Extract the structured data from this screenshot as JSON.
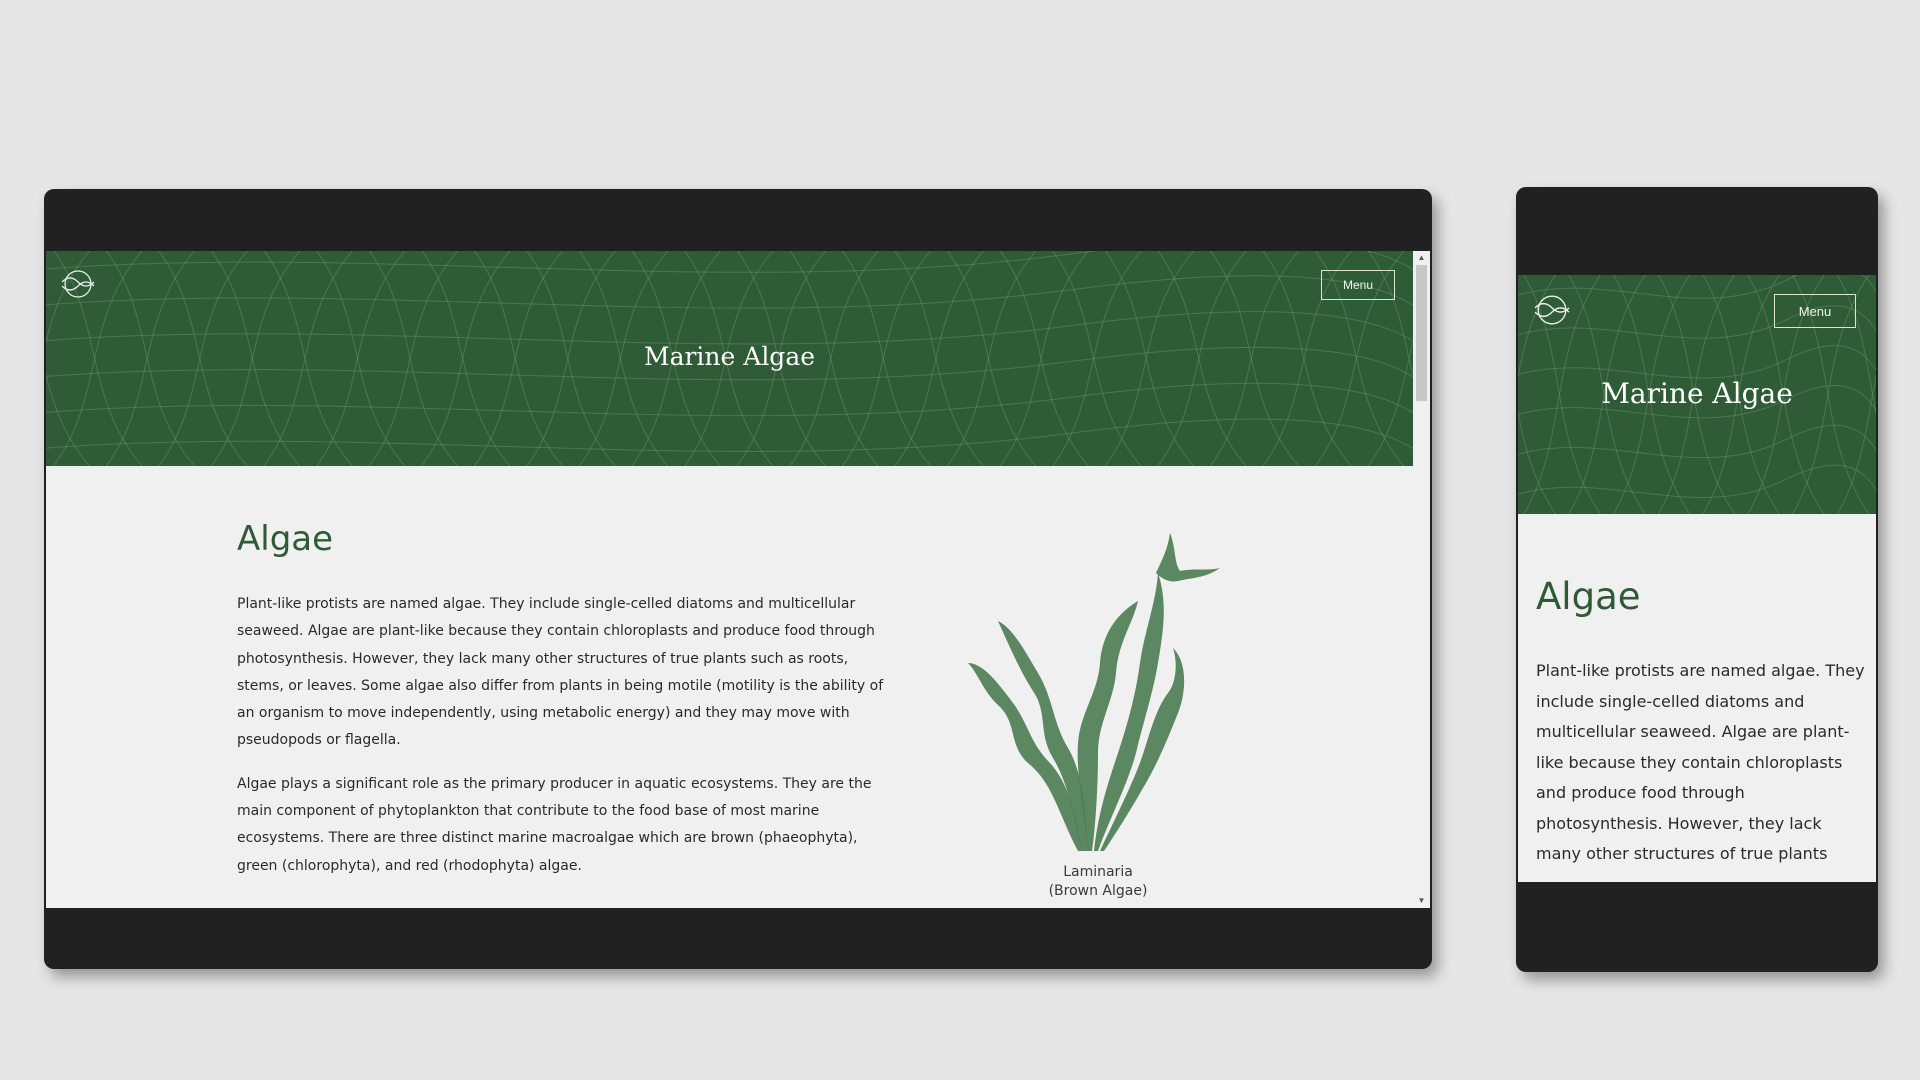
{
  "site": {
    "title": "Marine Algae",
    "menu_label": "Menu"
  },
  "article": {
    "heading": "Algae",
    "paragraph1": "Plant-like protists are named algae. They include single-celled diatoms and multicellular seaweed. Algae are plant-like because they contain chloroplasts and produce food through photosynthesis. However, they lack many other structures of true plants such as roots, stems, or leaves. Some algae also differ from plants in being motile (motility is the ability of an organism to move independently, using metabolic energy) and they may move with pseudopods or flagella.",
    "paragraph2": "Algae plays a significant role as the primary producer in aquatic ecosystems. They are the main component of phytoplankton that contribute to the food base of most marine ecosystems. There are three distinct marine macroalgae which are brown (phaeophyta), green (chlorophyta), and red (rhodophyta) algae.",
    "figure_caption_line1": "Laminaria",
    "figure_caption_line2": "(Brown Algae)"
  },
  "mobile": {
    "paragraph_visible": "Plant-like protists are named algae. They include single-celled diatoms and multicellular seaweed. Algae are plant-like because they contain chloroplasts and produce food through photosynthesis. However, they lack many other structures of true plants"
  },
  "icons": {
    "logo": "wave-globe-logo-icon",
    "figure": "seaweed-illustration"
  },
  "colors": {
    "background": "#e6e6e6",
    "device_frame": "#212121",
    "hero_green": "#2f5c36",
    "heading_green": "#2e5a35",
    "seaweed_green": "#4e7e55",
    "page_bg": "#f0f0f0"
  }
}
